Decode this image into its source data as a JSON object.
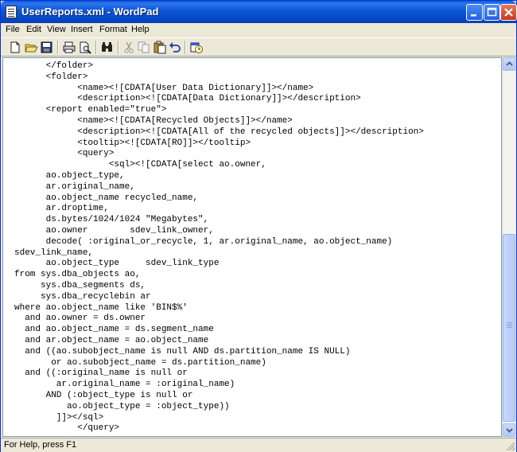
{
  "window": {
    "title": "UserReports.xml - WordPad"
  },
  "menu": {
    "items": [
      "File",
      "Edit",
      "View",
      "Insert",
      "Format",
      "Help"
    ]
  },
  "toolbar": {
    "icons": [
      "new-icon",
      "open-icon",
      "save-icon",
      "print-icon",
      "print-preview-icon",
      "find-icon",
      "cut-icon",
      "copy-icon",
      "paste-icon",
      "undo-icon",
      "date-time-icon"
    ]
  },
  "document": {
    "lines": [
      "      </folder>",
      "      <folder>",
      "            <name><![CDATA[User Data Dictionary]]></name>",
      "            <description><![CDATA[Data Dictionary]]></description>",
      "      <report enabled=\"true\">",
      "            <name><![CDATA[Recycled Objects]]></name>",
      "            <description><![CDATA[All of the recycled objects]]></description>",
      "            <tooltip><![CDATA[RO]]></tooltip>",
      "            <query>",
      "                  <sql><![CDATA[select ao.owner,",
      "      ao.object_type,",
      "      ar.original_name,",
      "      ao.object_name recycled_name,",
      "      ar.droptime,",
      "      ds.bytes/1024/1024 \"Megabytes\",",
      "      ao.owner        sdev_link_owner,",
      "      decode( :original_or_recycle, 1, ar.original_name, ao.object_name)",
      "sdev_link_name,",
      "      ao.object_type     sdev_link_type",
      "from sys.dba_objects ao,",
      "     sys.dba_segments ds,",
      "     sys.dba_recyclebin ar",
      "where ao.object_name like 'BIN$%'",
      "  and ao.owner = ds.owner",
      "  and ao.object_name = ds.segment_name",
      "  and ar.object_name = ao.object_name",
      "  and ((ao.subobject_name is null AND ds.partition_name IS NULL)",
      "       or ao.subobject_name = ds.partition_name)",
      "  and ((:original_name is null or",
      "        ar.original_name = :original_name)",
      "      AND (:object_type is null or",
      "          ao.object_type = :object_type))",
      "        ]]></sql>",
      "            </query>"
    ]
  },
  "status": {
    "text": "For Help, press F1"
  }
}
